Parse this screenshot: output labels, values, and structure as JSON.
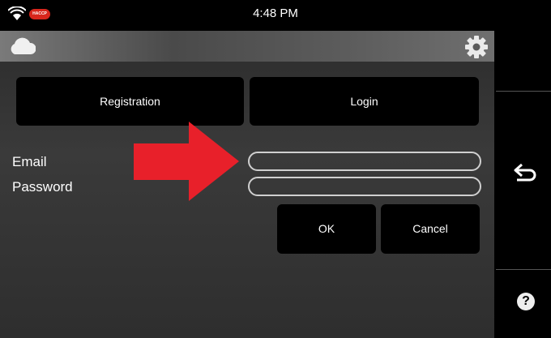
{
  "status": {
    "time": "4:48 PM",
    "badge": "HACCP"
  },
  "header": {
    "left_icon": "cloud-icon",
    "right_icon": "gear-icon"
  },
  "tabs": {
    "registration": "Registration",
    "login": "Login"
  },
  "form": {
    "email_label": "Email",
    "password_label": "Password",
    "email_value": "",
    "password_value": "",
    "ok": "OK",
    "cancel": "Cancel"
  },
  "sidebar": {
    "back_icon": "back-arrow-icon",
    "help": "?"
  },
  "colors": {
    "arrow": "#e8202a",
    "badge": "#d8261c",
    "field_border": "#d0d0d0"
  }
}
